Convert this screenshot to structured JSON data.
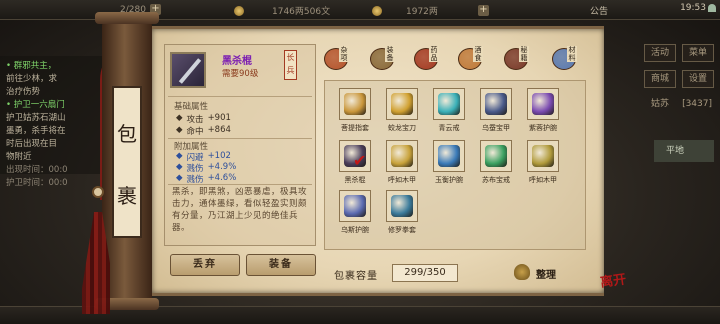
{
  "hud": {
    "stamina": "2/280",
    "money": "1746两506文",
    "gold": "1972两",
    "announcement": "公告",
    "time": "19:53"
  },
  "quest_log": {
    "lines": [
      {
        "text": "• 群邪共主，",
        "style": "title"
      },
      {
        "text": "  前往少林，求",
        "style": "normal"
      },
      {
        "text": "  治疗伤势",
        "style": "normal"
      },
      {
        "text": "• 护卫一六扇门",
        "style": "title"
      },
      {
        "text": "护卫姑苏石湖山",
        "style": "normal"
      },
      {
        "text": "墨勇，杀手将在",
        "style": "normal"
      },
      {
        "text": "时后出现在目",
        "style": "normal"
      },
      {
        "text": "物附近",
        "style": "normal"
      },
      {
        "text": "出现时间：00:0",
        "style": "dim"
      },
      {
        "text": "护卫时间：00:0",
        "style": "dim"
      }
    ]
  },
  "right_menu": {
    "buttons": [
      "活动",
      "菜单",
      "商城",
      "设置",
      "姑苏"
    ],
    "coord": "[3437]",
    "zone": "平地"
  },
  "panel": {
    "title_chars": [
      "包",
      "裹"
    ],
    "item": {
      "name": "黑杀棍",
      "requirement": "需要90级",
      "type_tag": "长兵"
    },
    "base_title": "基础属性",
    "base_attrs": [
      {
        "label": "攻击",
        "value": "+901"
      },
      {
        "label": "命中",
        "value": "+864"
      }
    ],
    "extra_title": "附加属性",
    "extra_attrs": [
      {
        "label": "闪避",
        "value": "+102"
      },
      {
        "label": "溅伤",
        "value": "+4.9%"
      },
      {
        "label": "溅伤",
        "value": "+4.6%"
      }
    ],
    "description": "黑杀，即黑煞，凶恶暴虐，极具攻击力，通体墨绿，看似轻盈实则颇有分量，乃江湖上少见的绝佳兵器。",
    "buttons": {
      "discard": "丢弃",
      "equip": "装备"
    },
    "tabs": [
      {
        "label": "杂项",
        "icon": "misc-icon",
        "color": "#b5542c"
      },
      {
        "label": "装备",
        "icon": "equipment-icon",
        "color": "#8a6a3a"
      },
      {
        "label": "药品",
        "icon": "medicine-icon",
        "color": "#a43a22"
      },
      {
        "label": "酒食",
        "icon": "food-icon",
        "color": "#c07a3a"
      },
      {
        "label": "秘籍",
        "icon": "manual-icon",
        "color": "#7a3a2a"
      },
      {
        "label": "材料",
        "icon": "material-icon",
        "color": "#5a7ab0"
      }
    ],
    "items": [
      {
        "name": "菩提指套",
        "color": "#c9963a",
        "equipped": false
      },
      {
        "name": "蛟龙宝刀",
        "color": "#d0a030",
        "equipped": false
      },
      {
        "name": "青云戒",
        "color": "#3ab0b8",
        "equipped": false
      },
      {
        "name": "乌蚕宝甲",
        "color": "#4a5a8a",
        "equipped": false
      },
      {
        "name": "紫蓉护腕",
        "color": "#7a4ab0",
        "equipped": false
      },
      {
        "name": "黑杀棍",
        "color": "#4a3e5a",
        "equipped": true
      },
      {
        "name": "呼如木甲",
        "color": "#c8a23a",
        "equipped": false
      },
      {
        "name": "玉衡护腕",
        "color": "#3a7ab8",
        "equipped": false
      },
      {
        "name": "苏布宝戒",
        "color": "#3aa060",
        "equipped": false
      },
      {
        "name": "呼如木甲",
        "color": "#b09a3a",
        "equipped": false
      },
      {
        "name": "乌斯护腕",
        "color": "#5a6ab0",
        "equipped": false
      },
      {
        "name": "修罗拳套",
        "color": "#3a7a9a",
        "equipped": false
      }
    ],
    "capacity_label": "包裹容量",
    "capacity_value": "299/350",
    "sort_label": "整理",
    "stamp": "离开"
  }
}
